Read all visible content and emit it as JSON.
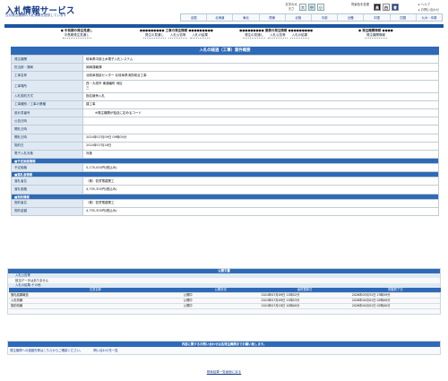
{
  "header": {
    "logo": "入札情報サービス",
    "tagline": "公共発注機関の入札情報を提供しています",
    "font_size_label": "文字の大きさ",
    "font_sizes": [
      "大",
      "中",
      "小"
    ],
    "color_label": "背景色を変更",
    "colors": [
      "黒",
      "白",
      "青"
    ],
    "help": "ヘルプ",
    "contact": "お問い合わせ"
  },
  "regions": [
    "全国",
    "北海道",
    "東北",
    "関東",
    "北陸",
    "中部",
    "近畿",
    "中国",
    "四国",
    "九州・沖縄"
  ],
  "menu": [
    {
      "title": "中長期の発注見通し",
      "items": [
        "中長期発注見通し"
      ]
    },
    {
      "title": "工事の発注情報",
      "items": [
        "発注の見通し",
        "入札公告等",
        "入札の結果"
      ]
    },
    {
      "title": "業務の発注情報",
      "items": [
        "発注の見通し",
        "入札公告等",
        "入札の結果"
      ]
    },
    {
      "title": "発注機関情報",
      "items": [
        "発注機関情報"
      ]
    }
  ],
  "section_title": "入札の経過（工事）案件概要",
  "details": [
    {
      "k": "発注機関",
      "v": "岐阜県中部土木電子入札システム"
    },
    {
      "k": "担当部・課局",
      "v": "岡崎運輸課"
    },
    {
      "k": "工事名称",
      "v": "北岐阜相談センター 北岐阜県消防総合工事"
    },
    {
      "k": "工事場所",
      "v": "西・大垣市 東通番町 地区",
      "v2": "三"
    },
    {
      "k": "入札契約方式",
      "v": "指名競争入札"
    },
    {
      "k": "工事種別／工事の業種",
      "v": "建工事"
    },
    {
      "k": "設計書番号",
      "v": "",
      "note": "※発注機関が独自に定めるコード"
    },
    {
      "k": "公告日時",
      "v": ""
    },
    {
      "k": "開札日時",
      "v": ""
    },
    {
      "k": "開札日時",
      "v": "2024年07月09日 09時00分"
    },
    {
      "k": "契約日",
      "v": "2024年07月18日"
    },
    {
      "k": "電子入札対象",
      "v": "対象"
    }
  ],
  "estimate": {
    "header": "予定価格情報",
    "k": "予定価格",
    "v": "5,170,000円(税込み)"
  },
  "winner": {
    "header": "落札者情報",
    "rows": [
      {
        "k": "落札者名",
        "v": "（株）佐賀電建業工"
      },
      {
        "k": "落札価格",
        "v": "4,755,300円(税込み)"
      }
    ]
  },
  "contract": {
    "header": "契約情報",
    "rows": [
      {
        "k": "契約者名",
        "v": "（株）佐賀電建業工"
      },
      {
        "k": "契約金額",
        "v": "4,755,300円(税込み)"
      }
    ]
  },
  "public": {
    "header": "公開文書",
    "sub1": "入札公告等",
    "none": "該当データはありません",
    "sub2": "入札の結果-その他",
    "cols": [
      "文書名称",
      "公開状況",
      "最終更新日",
      "掲載終了日"
    ],
    "rows": [
      [
        "落札結果報告",
        "公開中",
        "2024年07月09日 11時52分",
        "2026年03月31日 23時59分"
      ],
      [
        "入札情報",
        "公開中",
        "2024年07月09日 11時53分",
        "2026年04月01日 02時00分"
      ],
      [
        "契約情報",
        "公開中",
        "2024年07月18日 10時00分",
        "2026年04月01日 02時00分"
      ]
    ]
  },
  "contact": {
    "header": "内容に関するお問い合わせは各発注機関までお願い致します。",
    "link1": "発注機関への連絡先等はこちらからご確認ください。",
    "link2": "問い合わせ先一覧"
  },
  "back_link": "検索結果一覧画面に戻る",
  "accent": "#2e6ab7"
}
